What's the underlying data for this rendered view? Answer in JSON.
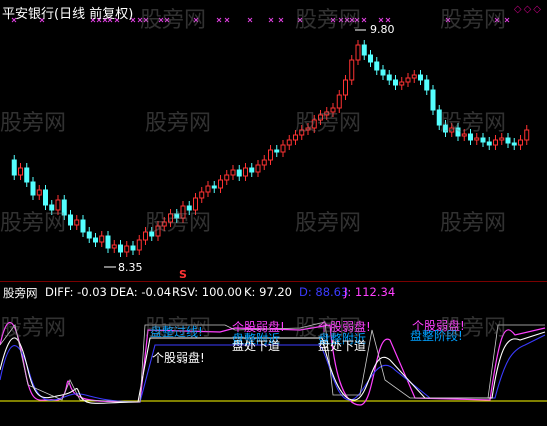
{
  "title": "平安银行(日线 前复权)",
  "watermark": "股旁网",
  "price_high_label": "9.80",
  "price_low_label": "8.35",
  "signal_marker": "S",
  "indicator_bar": {
    "name": "股旁网",
    "diff": "DIFF: -0.03",
    "dea": "DEA: -0.04",
    "rsv": "RSV: 100.00",
    "k": "K: 97.20",
    "d": "D: 88.63",
    "j": "J: 112.34"
  },
  "annotations": {
    "zone1_top": "盘整过线!",
    "zone1_bottom": "个股弱盘!",
    "zone2_top": "个股弱盘!",
    "zone2_mid": "盘整附近",
    "zone2_bottom": "盘处下道",
    "zone3_top": "个股弱盘!",
    "zone3_mid": "盘整附近",
    "zone3_bottom": "盘处下道",
    "zone4_top": "个股弱盘!",
    "zone4_bottom": "盘整阶段!"
  },
  "colors": {
    "up": "#ff3333",
    "down": "#54ffff",
    "diff": "#ffffff",
    "dea": "#ffff00",
    "rsv": "#ffffff",
    "k": "#ffffff",
    "d": "#3b3bff",
    "j": "#ff40ff",
    "magenta_marks": "#e040e0"
  },
  "chart_data": {
    "type": "candlestick",
    "price_labels": {
      "high": 9.8,
      "low": 8.35
    },
    "indicator_values": {
      "DIFF": -0.03,
      "DEA": -0.04,
      "RSV": 100.0,
      "K": 97.2,
      "D": 88.63,
      "J": 112.34
    }
  }
}
